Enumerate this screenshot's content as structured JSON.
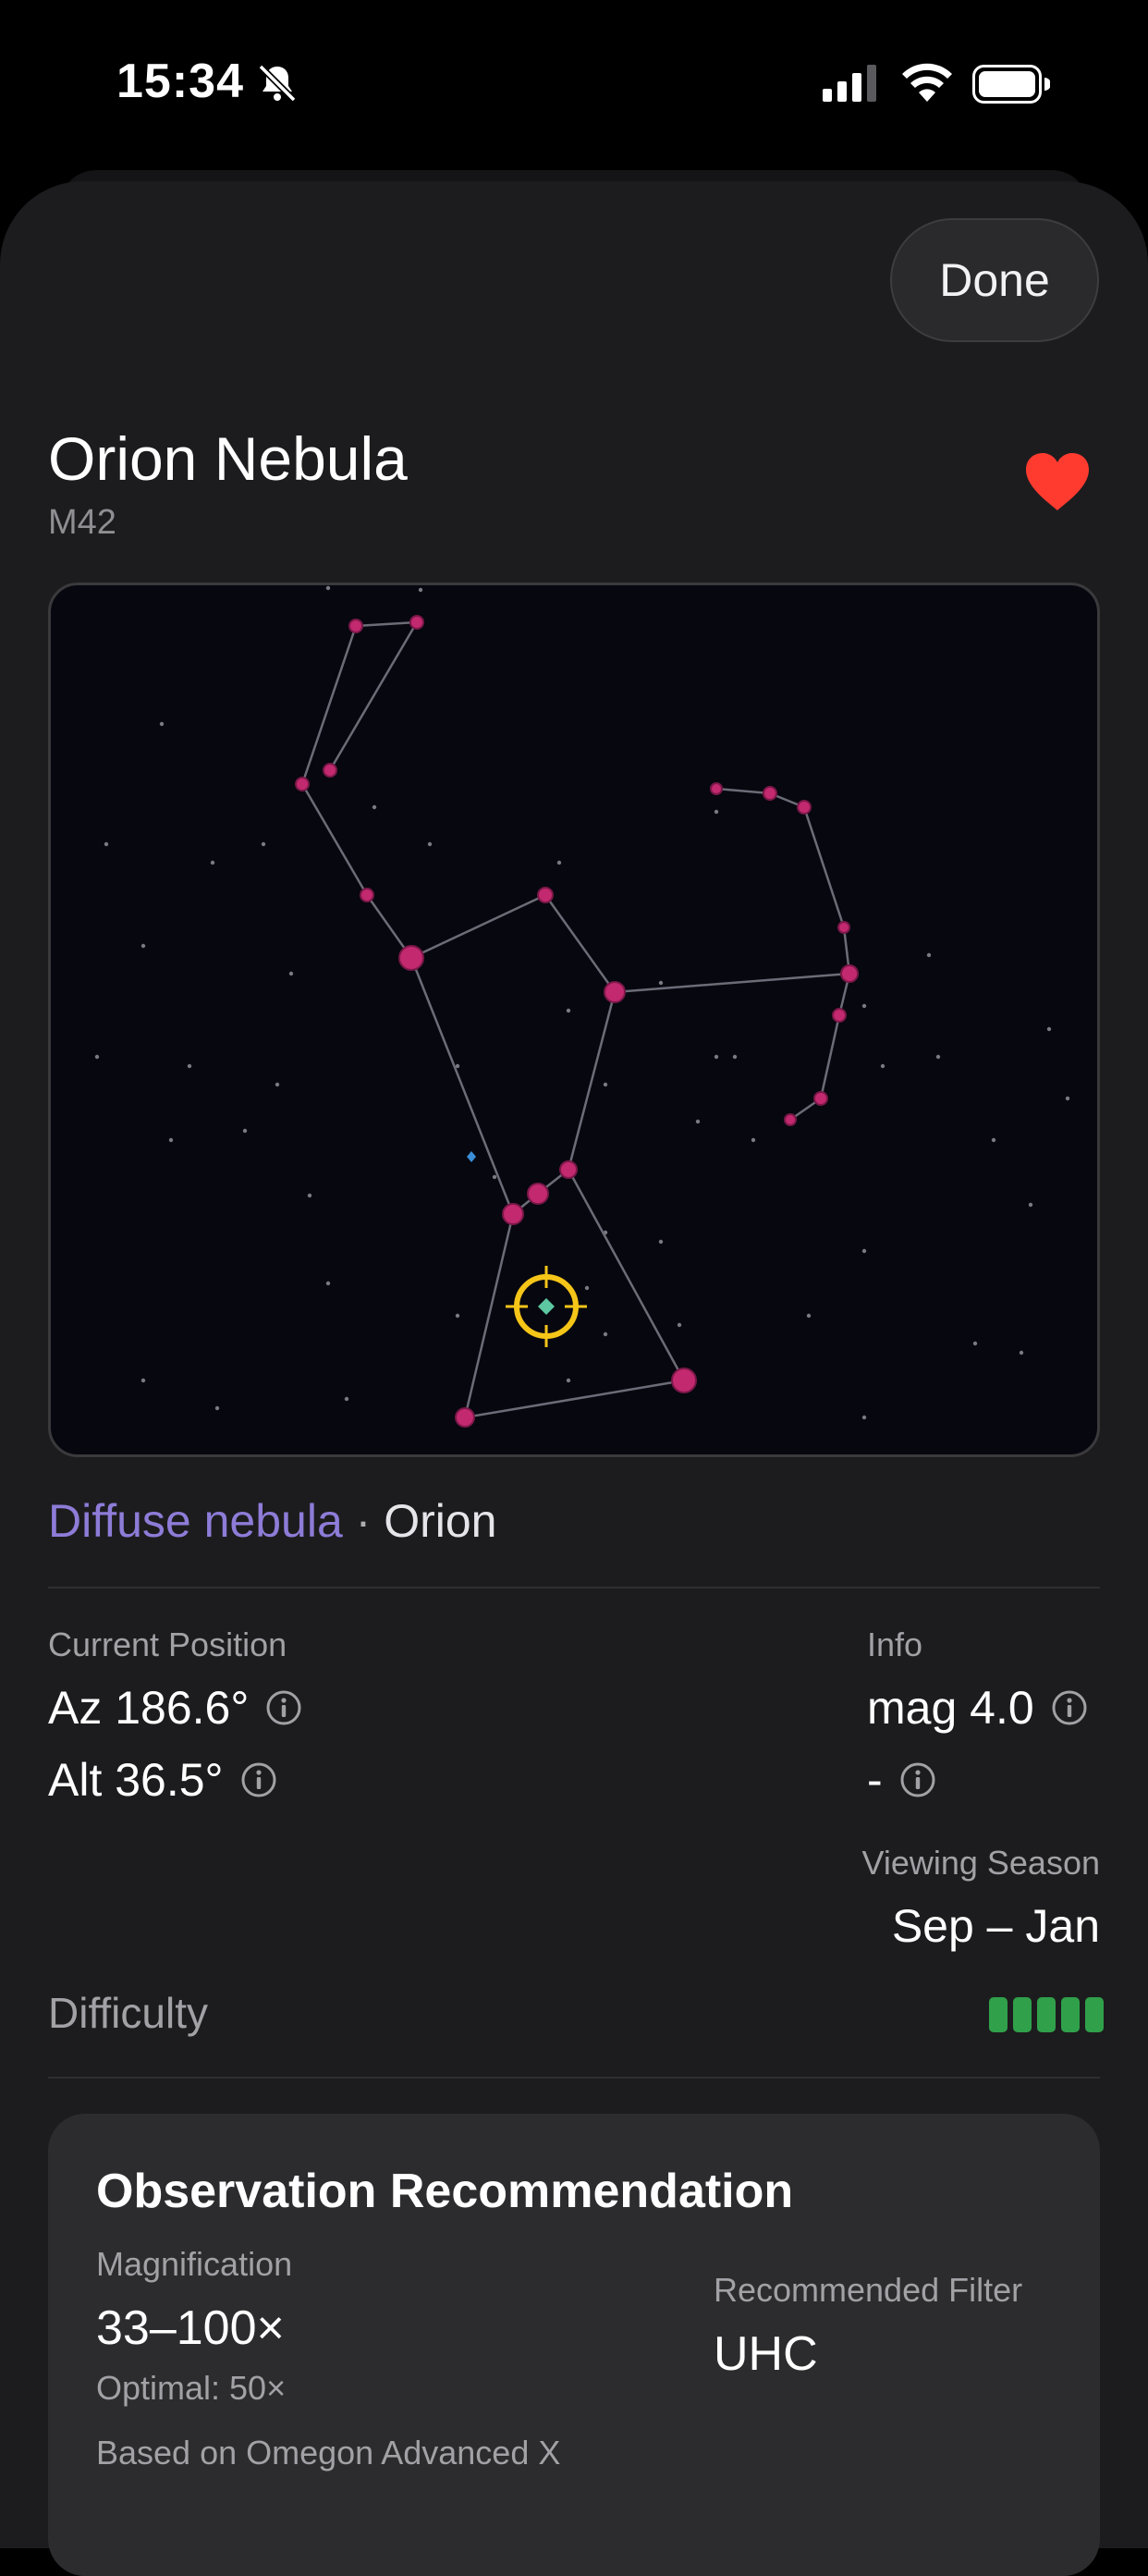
{
  "status_bar": {
    "time": "15:34"
  },
  "header": {
    "done_label": "Done"
  },
  "object": {
    "name": "Orion Nebula",
    "catalog_id": "M42",
    "favorite": true,
    "type": "Diffuse nebula",
    "separator": "·",
    "constellation": "Orion"
  },
  "position": {
    "heading": "Current Position",
    "az": "Az 186.6°",
    "alt": "Alt 36.5°"
  },
  "info": {
    "heading": "Info",
    "magnitude": "mag 4.0",
    "size": "-"
  },
  "season": {
    "heading": "Viewing Season",
    "value": "Sep – Jan"
  },
  "difficulty": {
    "label": "Difficulty",
    "level": 5,
    "max": 5,
    "color": "#30a04a"
  },
  "recommendation": {
    "title": "Observation Recommendation",
    "magnification_label": "Magnification",
    "magnification_value": "33–100×",
    "optimal": "Optimal: 50×",
    "filter_label": "Recommended Filter",
    "filter_value": "UHC",
    "based_on": "Based on Omegon Advanced X"
  },
  "colors": {
    "accent_purple": "#8e7cd8",
    "favorite_red": "#ff3b30",
    "star_magenta": "#c2296f",
    "target_yellow": "#f5c518"
  },
  "icons": [
    "bell-slash-icon",
    "cellular-signal-icon",
    "wifi-icon",
    "battery-icon",
    "heart-icon",
    "info-icon",
    "crosshair-target-icon"
  ]
}
